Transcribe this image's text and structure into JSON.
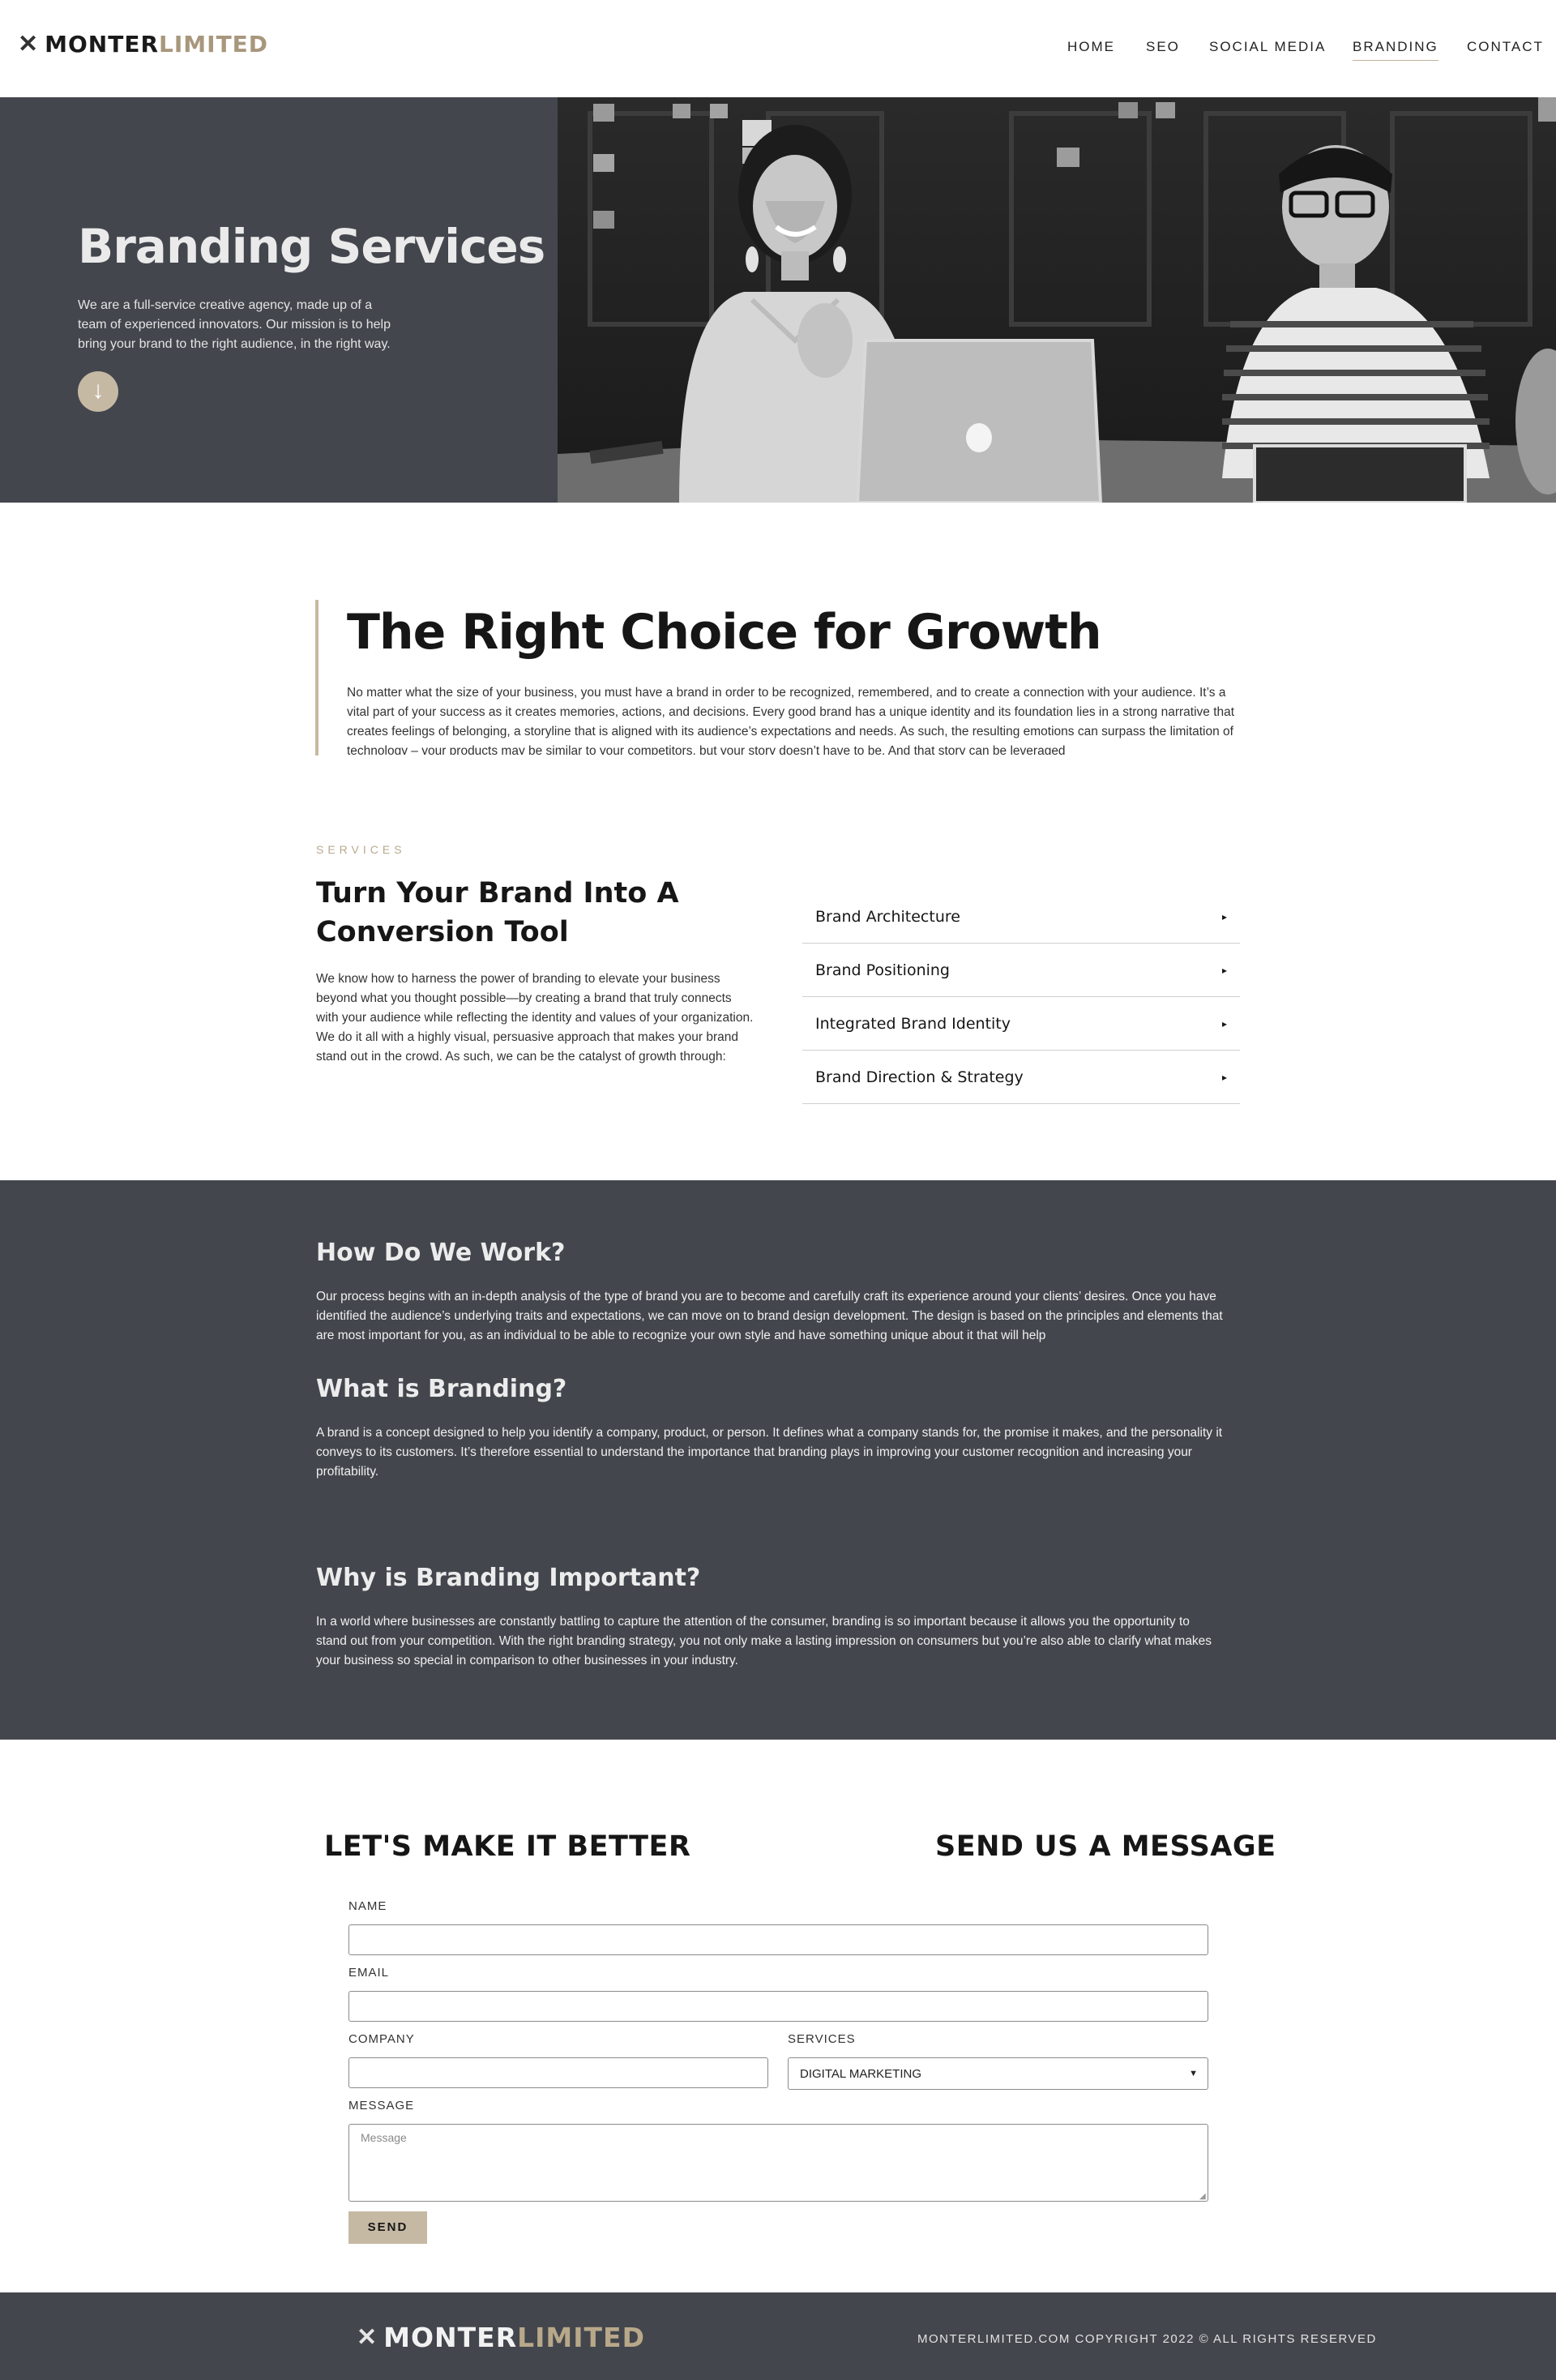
{
  "brand": {
    "logo_dark": "MONTER",
    "logo_light": "LIMITED",
    "logo_mark": "✕"
  },
  "nav": {
    "items": [
      {
        "label": "HOME"
      },
      {
        "label": "SEO"
      },
      {
        "label": "SOCIAL MEDIA"
      },
      {
        "label": "BRANDING",
        "active": true
      },
      {
        "label": "CONTACT"
      }
    ]
  },
  "hero": {
    "title": "Branding Services",
    "description": "We are a full-service creative agency, made up of a team of experienced innovators. Our mission is to help bring your brand to the right audience, in the right way.",
    "scroll_icon": "arrow-down-icon"
  },
  "growth": {
    "title": "The Right Choice for Growth",
    "text": "No matter what the size of your business, you must have a brand in order to be recognized, remembered, and to create a connection with your audience. It’s a vital part of your success as it creates memories, actions, and decisions. Every good brand has a unique identity and its foundation lies in a strong narrative that creates feelings of belonging, a storyline that is aligned with its audience’s expectations and needs. As such, the resulting emotions can surpass the limitation of technology – your products may be similar to your competitors, but your story doesn’t have to be. And that story can be leveraged"
  },
  "services": {
    "eyebrow": "SERVICES",
    "title": "Turn Your Brand Into A Conversion Tool",
    "text": "We know how to harness the power of branding to elevate your business beyond what you thought possible—by creating a brand that truly connects with your audience while reflecting the identity and values of your organization. We do it all with a highly visual, persuasive approach that makes your brand stand out in the crowd. As such, we can be the catalyst of growth through:",
    "items": [
      {
        "label": "Brand Architecture"
      },
      {
        "label": "Brand Positioning"
      },
      {
        "label": "Integrated Brand Identity"
      },
      {
        "label": "Brand Direction & Strategy"
      }
    ],
    "caret": "▸"
  },
  "info": {
    "blocks": [
      {
        "title": "How Do We Work?",
        "text": "Our process begins with an in-depth analysis of the type of brand you are to become and carefully craft its experience around your clients’ desires. Once you have identified the audience’s underlying traits and expectations, we can move on to brand design development. The design is based on the principles and elements that are most important for you, as an individual to be able to recognize your own style and have something unique about it that will help"
      },
      {
        "title": "What is Branding?",
        "text": "A brand is a concept designed to help you identify a company, product, or person. It defines what a company stands for, the promise it makes, and the personality it conveys to its customers. It’s therefore essential to understand the importance that branding plays in improving your customer recognition and increasing your profitability."
      },
      {
        "title": "Why is Branding Important?",
        "text": "In a world where businesses are constantly battling to capture the attention of the consumer, branding is so important because it allows you the opportunity to stand out from your competition. With the right branding strategy, you not only make a lasting impression on consumers but you’re also able to clarify what makes your business so special in comparison to other businesses in your industry."
      }
    ]
  },
  "contact": {
    "heading_left": "LET'S MAKE IT BETTER",
    "heading_right": "SEND US A MESSAGE",
    "labels": {
      "name": "NAME",
      "email": "EMAIL",
      "company": "COMPANY",
      "services": "SERVICES",
      "message": "MESSAGE"
    },
    "values": {
      "name": "",
      "email": "",
      "company": ""
    },
    "services_selected": "DIGITAL MARKETING",
    "message_placeholder": "Message",
    "send_label": "SEND"
  },
  "footer": {
    "copyright": "MONTERLIMITED.COM COPYRIGHT 2022 © ALL RIGHTS RESERVED"
  },
  "colors": {
    "accent": "#c6b9a4",
    "dark": "#43464d",
    "text": "#161616"
  }
}
